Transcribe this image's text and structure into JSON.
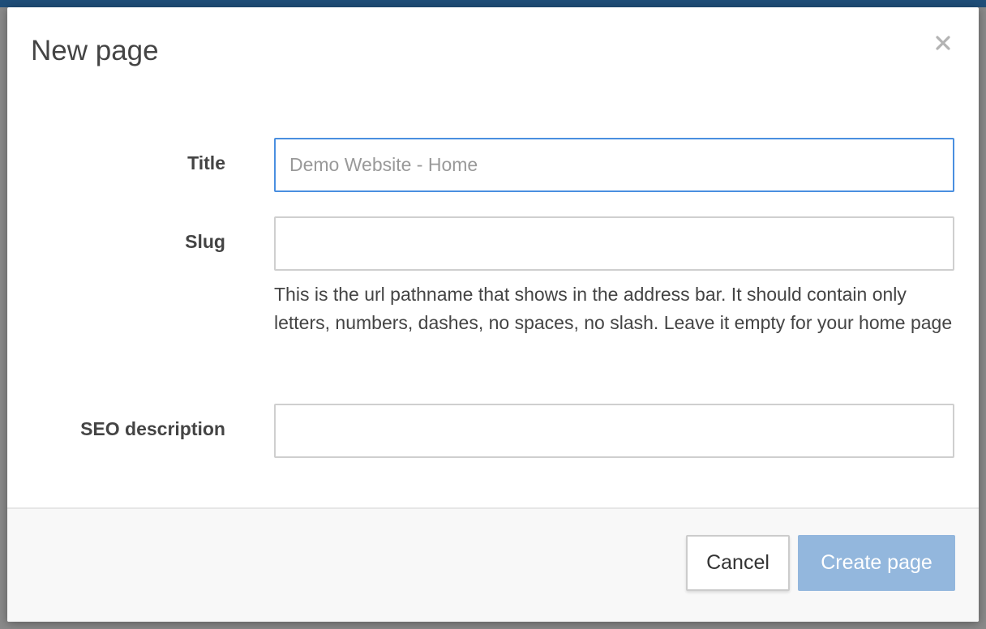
{
  "dialog": {
    "title": "New page",
    "close_symbol": "×"
  },
  "form": {
    "title": {
      "label": "Title",
      "placeholder": "Demo Website - Home",
      "value": ""
    },
    "slug": {
      "label": "Slug",
      "placeholder": "",
      "value": "",
      "help": "This is the url pathname that shows in the address bar. It should contain only letters, numbers, dashes, no spaces, no slash. Leave it empty for your home page"
    },
    "seo_description": {
      "label": "SEO description",
      "placeholder": "",
      "value": ""
    }
  },
  "footer": {
    "cancel_label": "Cancel",
    "create_label": "Create page"
  },
  "colors": {
    "top_bar": "#1f4e79",
    "focus_border": "#4a8fe0",
    "primary_disabled": "#93b7dd"
  },
  "icons": {
    "close": "close-icon"
  }
}
